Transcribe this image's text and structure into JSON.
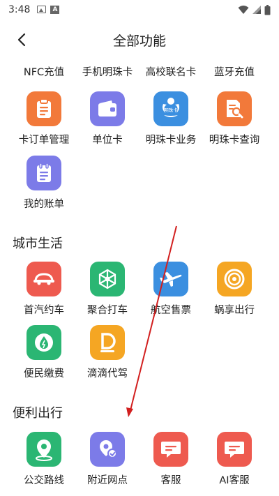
{
  "status": {
    "time": "3:48"
  },
  "header": {
    "title": "全部功能"
  },
  "top_row": {
    "items": [
      {
        "label": "NFC充值"
      },
      {
        "label": "手机明珠卡"
      },
      {
        "label": "高校联名卡"
      },
      {
        "label": "蓝牙充值"
      }
    ]
  },
  "card_section": {
    "items": [
      {
        "label": "卡订单管理",
        "icon": "clipboard-icon",
        "color": "#F2793A"
      },
      {
        "label": "单位卡",
        "icon": "wallet-icon",
        "color": "#7C7BE8"
      },
      {
        "label": "明珠卡业务",
        "icon": "pearl-card-icon",
        "color": "#3B8FE0",
        "icon_text": "明珠卡"
      },
      {
        "label": "明珠卡查询",
        "icon": "doc-search-icon",
        "color": "#F2793A"
      },
      {
        "label": "我的账单",
        "icon": "bill-icon",
        "color": "#7C7BE8"
      }
    ]
  },
  "city_section": {
    "title": "城市生活",
    "items": [
      {
        "label": "首汽约车",
        "icon": "car-icon",
        "color": "#EE5A4F"
      },
      {
        "label": "聚合打车",
        "icon": "network-icon",
        "color": "#2BB673"
      },
      {
        "label": "航空售票",
        "icon": "plane-icon",
        "color": "#3B8FE0"
      },
      {
        "label": "蜗享出行",
        "icon": "snail-icon",
        "color": "#F5A623"
      },
      {
        "label": "便民缴费",
        "icon": "drop-icon",
        "color": "#2BB673"
      },
      {
        "label": "滴滴代驾",
        "icon": "didi-icon",
        "color": "#F5A623"
      }
    ]
  },
  "travel_section": {
    "title": "便利出行",
    "items": [
      {
        "label": "公交路线",
        "icon": "location-pin-icon",
        "color": "#2BB673"
      },
      {
        "label": "附近网点",
        "icon": "nearby-icon",
        "color": "#7C7BE8"
      },
      {
        "label": "客服",
        "icon": "chat-icon",
        "color": "#EE5A4F"
      },
      {
        "label": "AI客服",
        "icon": "ai-chat-icon",
        "color": "#EE5A4F"
      }
    ]
  },
  "annotation": {
    "arrow_color": "#D21F1F"
  }
}
